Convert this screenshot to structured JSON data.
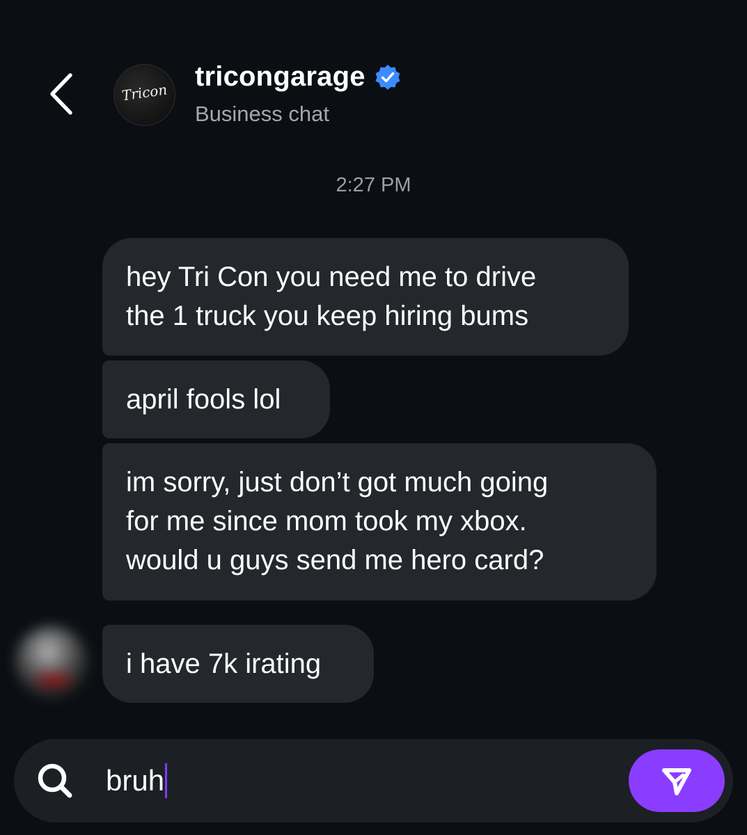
{
  "header": {
    "name": "tricongarage",
    "verified": true,
    "subtitle": "Business chat",
    "avatar_logo": "Tricon"
  },
  "timestamp": "2:27 PM",
  "messages": [
    {
      "text": "hey Tri Con you need me to drive\nthe 1 truck you keep hiring bums"
    },
    {
      "text": "april fools lol"
    },
    {
      "text": "im sorry, just don’t got much going\nfor me since mom took my xbox.\nwould u guys send me hero card?"
    },
    {
      "text": "i have 7k irating"
    }
  ],
  "composer": {
    "value": "bruh",
    "icon": "search-icon",
    "send_icon": "send-icon"
  },
  "colors": {
    "background": "#0b0e13",
    "bubble": "#24272c",
    "accent": "#8b3dff",
    "verified": "#3d8bfd"
  }
}
